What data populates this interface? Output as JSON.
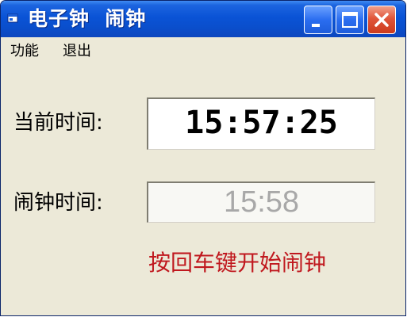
{
  "window": {
    "title": "电子钟  闹钟",
    "icon": "app-window-icon"
  },
  "controls": {
    "minimize_icon": "minimize-icon",
    "maximize_icon": "maximize-icon",
    "close_icon": "close-icon"
  },
  "menubar": {
    "items": [
      {
        "label": "功能"
      },
      {
        "label": "退出"
      }
    ]
  },
  "form": {
    "current_time_label": "当前时间:",
    "current_time_value": "15:57:25",
    "alarm_time_label": "闹钟时间:",
    "alarm_time_value": "15:58"
  },
  "hint": {
    "text": "按回车键开始闹钟",
    "color": "#c0181e"
  },
  "colors": {
    "titlebar": "#0a53d6",
    "window_face": "#ece9d8",
    "close_button": "#e0553a"
  }
}
